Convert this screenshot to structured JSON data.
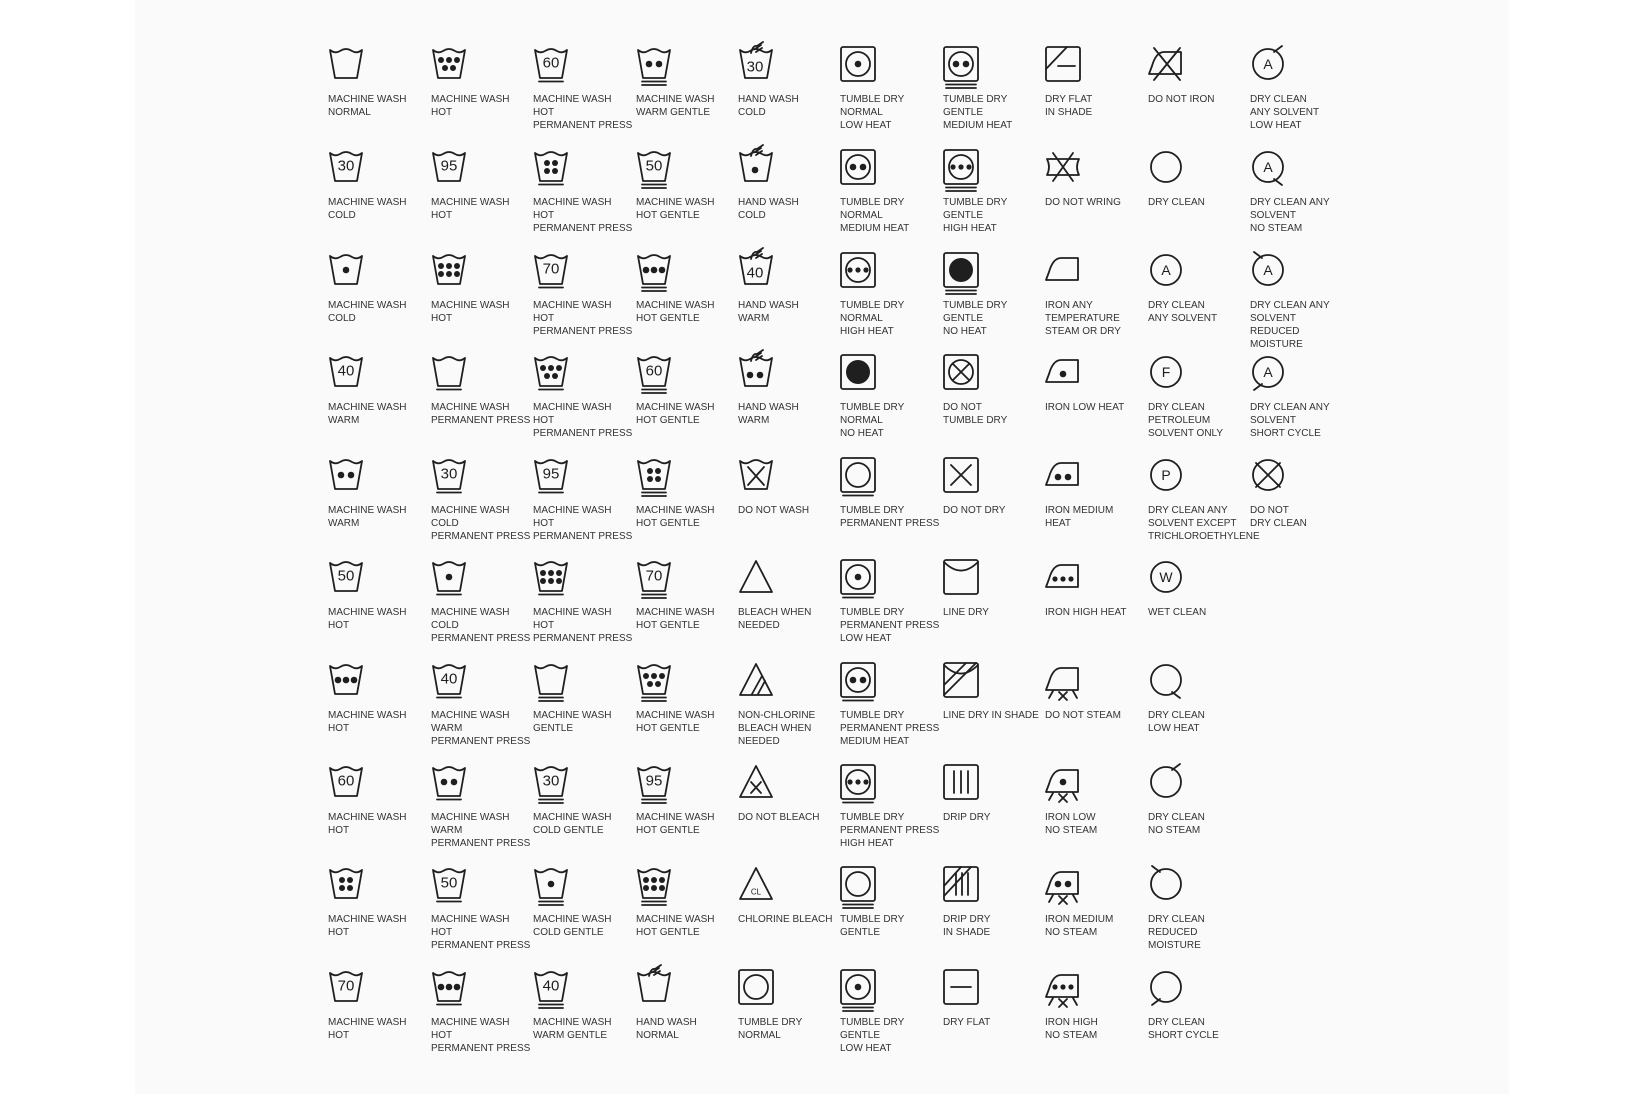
{
  "colors": {
    "ink": "#1f1f1f",
    "label": "#333333",
    "sheet": "#fafafa",
    "page": "#ffffff"
  },
  "columns": [
    [
      {
        "icon": "wash-normal-icon",
        "label": "MACHINE WASH\nNORMAL"
      },
      {
        "icon": "wash-30-icon",
        "text": "30",
        "label": "MACHINE WASH\nCOLD"
      },
      {
        "icon": "wash-1dot-icon",
        "label": "MACHINE WASH\nCOLD"
      },
      {
        "icon": "wash-40-icon",
        "text": "40",
        "label": "MACHINE WASH\nWARM"
      },
      {
        "icon": "wash-2dot-icon",
        "label": "MACHINE WASH\nWARM"
      },
      {
        "icon": "wash-50-icon",
        "text": "50",
        "label": "MACHINE WASH\nHOT"
      },
      {
        "icon": "wash-3dot-icon",
        "label": "MACHINE WASH\nHOT"
      },
      {
        "icon": "wash-60-icon",
        "text": "60",
        "label": "MACHINE WASH\nHOT"
      },
      {
        "icon": "wash-4dot-icon",
        "label": "MACHINE WASH\nHOT"
      },
      {
        "icon": "wash-70-icon",
        "text": "70",
        "label": "MACHINE WASH\nHOT"
      }
    ],
    [
      {
        "icon": "wash-5dot-icon",
        "label": "MACHINE WASH\nHOT"
      },
      {
        "icon": "wash-95-icon",
        "text": "95",
        "label": "MACHINE WASH\nHOT"
      },
      {
        "icon": "wash-6dot-icon",
        "label": "MACHINE WASH\nHOT"
      },
      {
        "icon": "wash-permanent-press-icon",
        "label": "MACHINE WASH\nPERMANENT PRESS"
      },
      {
        "icon": "wash-30-permanent-press-icon",
        "text": "30",
        "label": "MACHINE WASH\nCOLD\nPERMANENT PRESS"
      },
      {
        "icon": "wash-1dot-permanent-press-icon",
        "label": "MACHINE WASH\nCOLD\nPERMANENT PRESS"
      },
      {
        "icon": "wash-40-permanent-press-icon",
        "text": "40",
        "label": "MACHINE WASH\nWARM\nPERMANENT PRESS"
      },
      {
        "icon": "wash-2dot-permanent-press-icon",
        "label": "MACHINE WASH\nWARM\nPERMANENT PRESS"
      },
      {
        "icon": "wash-50-permanent-press-icon",
        "text": "50",
        "label": "MACHINE WASH\nHOT\nPERMANENT PRESS"
      },
      {
        "icon": "wash-3dot-permanent-press-icon",
        "label": "MACHINE WASH\nHOT\nPERMANENT PRESS"
      }
    ],
    [
      {
        "icon": "wash-60-permanent-press-icon",
        "text": "60",
        "label": "MACHINE WASH\nHOT\nPERMANENT PRESS"
      },
      {
        "icon": "wash-4dot-permanent-press-icon",
        "label": "MACHINE WASH\nHOT\nPERMANENT PRESS"
      },
      {
        "icon": "wash-70-permanent-press-icon",
        "text": "70",
        "label": "MACHINE WASH\nHOT\nPERMANENT PRESS"
      },
      {
        "icon": "wash-5dot-permanent-press-icon",
        "label": "MACHINE WASH\nHOT\nPERMANENT PRESS"
      },
      {
        "icon": "wash-95-permanent-press-icon",
        "text": "95",
        "label": "MACHINE WASH\nHOT\nPERMANENT PRESS"
      },
      {
        "icon": "wash-6dot-permanent-press-icon",
        "label": "MACHINE WASH\nHOT\nPERMANENT PRESS"
      },
      {
        "icon": "wash-gentle-icon",
        "label": "MACHINE WASH\nGENTLE"
      },
      {
        "icon": "wash-30-gentle-icon",
        "text": "30",
        "label": "MACHINE WASH\nCOLD GENTLE"
      },
      {
        "icon": "wash-1dot-gentle-icon",
        "label": "MACHINE WASH\nCOLD GENTLE"
      },
      {
        "icon": "wash-40-gentle-icon",
        "text": "40",
        "label": "MACHINE WASH\nWARM GENTLE"
      }
    ],
    [
      {
        "icon": "wash-2dot-gentle-icon",
        "label": "MACHINE WASH\nWARM GENTLE"
      },
      {
        "icon": "wash-50-gentle-icon",
        "text": "50",
        "label": "MACHINE WASH\nHOT GENTLE"
      },
      {
        "icon": "wash-3dot-gentle-icon",
        "label": "MACHINE WASH\nHOT GENTLE"
      },
      {
        "icon": "wash-60-gentle-icon",
        "text": "60",
        "label": "MACHINE WASH\nHOT GENTLE"
      },
      {
        "icon": "wash-4dot-gentle-icon",
        "label": "MACHINE WASH\nHOT GENTLE"
      },
      {
        "icon": "wash-70-gentle-icon",
        "text": "70",
        "label": "MACHINE WASH\nHOT GENTLE"
      },
      {
        "icon": "wash-5dot-gentle-icon",
        "label": "MACHINE WASH\nHOT GENTLE"
      },
      {
        "icon": "wash-95-gentle-icon",
        "text": "95",
        "label": "MACHINE WASH\nHOT GENTLE"
      },
      {
        "icon": "wash-6dot-gentle-icon",
        "label": "MACHINE WASH\nHOT GENTLE"
      },
      {
        "icon": "hand-wash-icon",
        "label": "HAND WASH\nNORMAL"
      }
    ],
    [
      {
        "icon": "hand-wash-30-icon",
        "text": "30",
        "label": "HAND WASH\nCOLD"
      },
      {
        "icon": "hand-wash-1dot-icon",
        "label": "HAND WASH\nCOLD"
      },
      {
        "icon": "hand-wash-40-icon",
        "text": "40",
        "label": "HAND WASH\nWARM"
      },
      {
        "icon": "hand-wash-2dot-icon",
        "label": "HAND WASH\nWARM"
      },
      {
        "icon": "do-not-wash-icon",
        "label": "DO NOT WASH"
      },
      {
        "icon": "bleach-icon",
        "label": "BLEACH WHEN\nNEEDED"
      },
      {
        "icon": "non-chlorine-bleach-icon",
        "label": "NON-CHLORINE\nBLEACH WHEN\nNEEDED"
      },
      {
        "icon": "do-not-bleach-icon",
        "label": "DO NOT BLEACH"
      },
      {
        "icon": "chlorine-bleach-icon",
        "text": "CL",
        "label": "CHLORINE BLEACH"
      },
      {
        "icon": "tumble-dry-normal-icon",
        "label": "TUMBLE DRY\nNORMAL"
      }
    ],
    [
      {
        "icon": "tumble-dry-low-icon",
        "label": "TUMBLE DRY\nNORMAL\nLOW HEAT"
      },
      {
        "icon": "tumble-dry-medium-icon",
        "label": "TUMBLE DRY\nNORMAL\nMEDIUM HEAT"
      },
      {
        "icon": "tumble-dry-high-icon",
        "label": "TUMBLE DRY\nNORMAL\nHIGH HEAT"
      },
      {
        "icon": "tumble-dry-no-heat-icon",
        "label": "TUMBLE DRY\nNORMAL\nNO HEAT"
      },
      {
        "icon": "tumble-dry-permanent-press-icon",
        "label": "TUMBLE DRY\nPERMANENT PRESS"
      },
      {
        "icon": "tumble-dry-pp-low-icon",
        "label": "TUMBLE DRY\nPERMANENT PRESS\nLOW HEAT"
      },
      {
        "icon": "tumble-dry-pp-medium-icon",
        "label": "TUMBLE DRY\nPERMANENT PRESS\nMEDIUM HEAT"
      },
      {
        "icon": "tumble-dry-pp-high-icon",
        "label": "TUMBLE DRY\nPERMANENT PRESS\nHIGH HEAT"
      },
      {
        "icon": "tumble-dry-gentle-icon",
        "label": "TUMBLE DRY\nGENTLE"
      },
      {
        "icon": "tumble-dry-gentle-low-icon",
        "label": "TUMBLE DRY\nGENTLE\nLOW HEAT"
      }
    ],
    [
      {
        "icon": "tumble-dry-gentle-medium-icon",
        "label": "TUMBLE DRY\nGENTLE\nMEDIUM HEAT"
      },
      {
        "icon": "tumble-dry-gentle-high-icon",
        "label": "TUMBLE DRY\nGENTLE\nHIGH HEAT"
      },
      {
        "icon": "tumble-dry-gentle-no-heat-icon",
        "label": "TUMBLE DRY\nGENTLE\nNO HEAT"
      },
      {
        "icon": "do-not-tumble-dry-icon",
        "label": "DO NOT\nTUMBLE DRY"
      },
      {
        "icon": "do-not-dry-icon",
        "label": "DO NOT DRY"
      },
      {
        "icon": "line-dry-icon",
        "label": "LINE DRY"
      },
      {
        "icon": "line-dry-shade-icon",
        "label": "LINE DRY IN SHADE"
      },
      {
        "icon": "drip-dry-icon",
        "label": "DRIP DRY"
      },
      {
        "icon": "drip-dry-shade-icon",
        "label": "DRIP DRY\nIN SHADE"
      },
      {
        "icon": "dry-flat-icon",
        "label": "DRY FLAT"
      }
    ],
    [
      {
        "icon": "dry-flat-shade-icon",
        "label": "DRY FLAT\nIN SHADE"
      },
      {
        "icon": "do-not-wring-icon",
        "label": "DO NOT WRING"
      },
      {
        "icon": "iron-any-icon",
        "label": "IRON ANY\nTEMPERATURE\nSTEAM OR DRY"
      },
      {
        "icon": "iron-low-icon",
        "label": "IRON LOW HEAT"
      },
      {
        "icon": "iron-medium-icon",
        "label": "IRON MEDIUM\nHEAT"
      },
      {
        "icon": "iron-high-icon",
        "label": "IRON HIGH HEAT"
      },
      {
        "icon": "do-not-steam-icon",
        "label": "DO NOT STEAM"
      },
      {
        "icon": "iron-low-no-steam-icon",
        "label": "IRON LOW\nNO STEAM"
      },
      {
        "icon": "iron-medium-no-steam-icon",
        "label": "IRON MEDIUM\nNO STEAM"
      },
      {
        "icon": "iron-high-no-steam-icon",
        "label": "IRON HIGH\nNO STEAM"
      }
    ],
    [
      {
        "icon": "do-not-iron-icon",
        "label": "DO NOT IRON"
      },
      {
        "icon": "dry-clean-icon",
        "label": "DRY CLEAN"
      },
      {
        "icon": "dry-clean-a-icon",
        "text": "A",
        "label": "DRY CLEAN\nANY SOLVENT"
      },
      {
        "icon": "dry-clean-f-icon",
        "text": "F",
        "label": "DRY CLEAN\nPETROLEUM\nSOLVENT ONLY"
      },
      {
        "icon": "dry-clean-p-icon",
        "text": "P",
        "label": "DRY CLEAN ANY\nSOLVENT EXCEPT\nTRICHLOROETHYLENE"
      },
      {
        "icon": "wet-clean-icon",
        "text": "W",
        "label": "WET CLEAN"
      },
      {
        "icon": "dry-clean-low-heat-icon",
        "label": "DRY CLEAN\nLOW HEAT"
      },
      {
        "icon": "dry-clean-no-steam-icon",
        "label": "DRY CLEAN\nNO STEAM"
      },
      {
        "icon": "dry-clean-reduced-moisture-icon",
        "label": "DRY CLEAN\nREDUCED MOISTURE"
      },
      {
        "icon": "dry-clean-short-cycle-icon",
        "label": "DRY CLEAN\nSHORT CYCLE"
      }
    ],
    [
      {
        "icon": "dry-clean-a-low-heat-icon",
        "text": "A",
        "label": "DRY CLEAN\nANY SOLVENT\nLOW HEAT"
      },
      {
        "icon": "dry-clean-a-no-steam-icon",
        "text": "A",
        "label": "DRY CLEAN ANY\nSOLVENT\nNO STEAM"
      },
      {
        "icon": "dry-clean-a-reduced-moisture-icon",
        "text": "A",
        "label": "DRY CLEAN ANY\nSOLVENT\nREDUCED\nMOISTURE"
      },
      {
        "icon": "dry-clean-a-short-cycle-icon",
        "text": "A",
        "label": "DRY CLEAN ANY\nSOLVENT\nSHORT CYCLE"
      },
      {
        "icon": "do-not-dry-clean-icon",
        "label": "DO NOT\nDRY CLEAN"
      }
    ]
  ]
}
